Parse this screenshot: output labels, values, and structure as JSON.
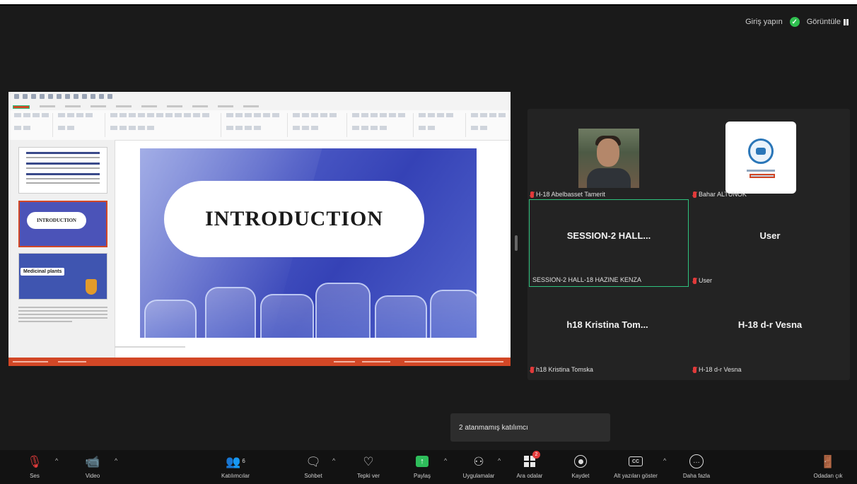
{
  "top_right": {
    "login_label": "Giriş yapın",
    "view_label": "Görüntüle"
  },
  "slide": {
    "title": "INTRODUCTION",
    "thumb2_title": "INTRODUCTION",
    "thumb3_title": "Medicinal plants"
  },
  "participants": [
    {
      "display": "",
      "name": "H-18 Abelbasset Tamerit",
      "muted": true,
      "has_video": true
    },
    {
      "display": "",
      "name": "Bahar ALTUNOK",
      "muted": true,
      "has_logo": true
    },
    {
      "display": "SESSION-2  HALL...",
      "name": "SESSION-2 HALL-18 HAZINE KENZA",
      "muted": false,
      "active_speaker": true
    },
    {
      "display": "User",
      "name": "User",
      "muted": true
    },
    {
      "display": "h18  Kristina  Tom...",
      "name": "h18 Kristina Tomska",
      "muted": true
    },
    {
      "display": "H-18 d-r Vesna",
      "name": "H-18 d-r Vesna",
      "muted": true
    }
  ],
  "toast": {
    "text": "2 atanmamış katılımcı"
  },
  "toolbar": {
    "audio": "Ses",
    "video": "Video",
    "participants": "Katılımcılar",
    "participants_count": "6",
    "chat": "Sohbet",
    "reactions": "Tepki ver",
    "share": "Paylaş",
    "apps": "Uygulamalar",
    "breakout": "Ara odalar",
    "breakout_badge": "2",
    "record": "Kaydet",
    "captions": "Alt yazıları göster",
    "more": "Daha fazla",
    "leave": "Odadan çık"
  },
  "colors": {
    "active_border": "#2ec27e",
    "ppt_accent": "#d24726",
    "share_green": "#2ebd5b",
    "mute_red": "#e23b3b"
  }
}
